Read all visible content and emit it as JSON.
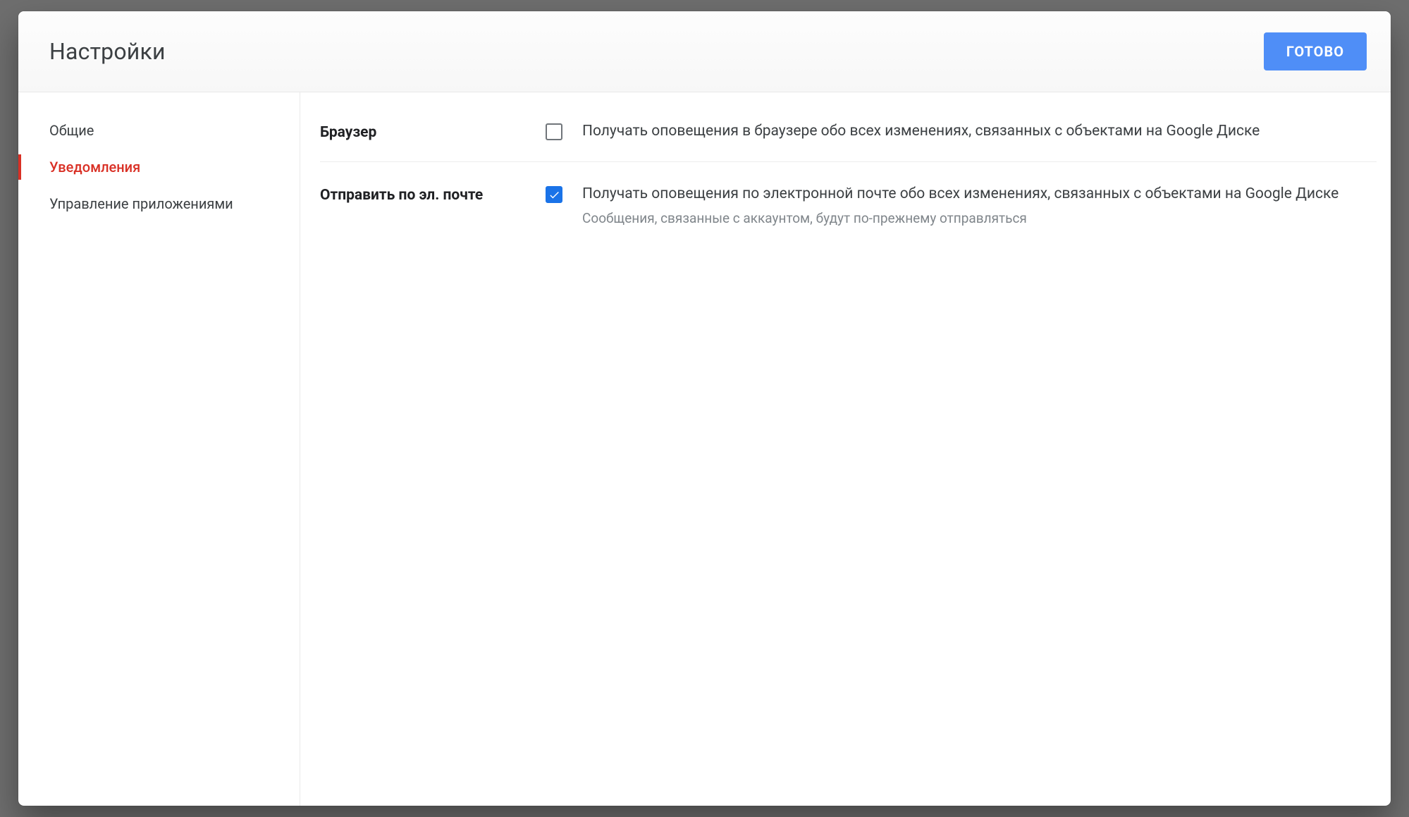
{
  "dialog": {
    "title": "Настройки",
    "done_label": "ГОТОВО"
  },
  "sidebar": {
    "items": [
      {
        "label": "Общие",
        "active": false
      },
      {
        "label": "Уведомления",
        "active": true
      },
      {
        "label": "Управление приложениями",
        "active": false
      }
    ]
  },
  "settings": {
    "browser": {
      "label": "Браузер",
      "checked": false,
      "desc": "Получать оповещения в браузере обо всех изменениях, связанных с объектами на Google Диске"
    },
    "email": {
      "label": "Отправить по эл. почте",
      "checked": true,
      "desc": "Получать оповещения по электронной почте обо всех изменениях, связанных с объектами на Google Диске",
      "hint": "Сообщения, связанные с аккаунтом, будут по-прежнему отправляться"
    }
  }
}
